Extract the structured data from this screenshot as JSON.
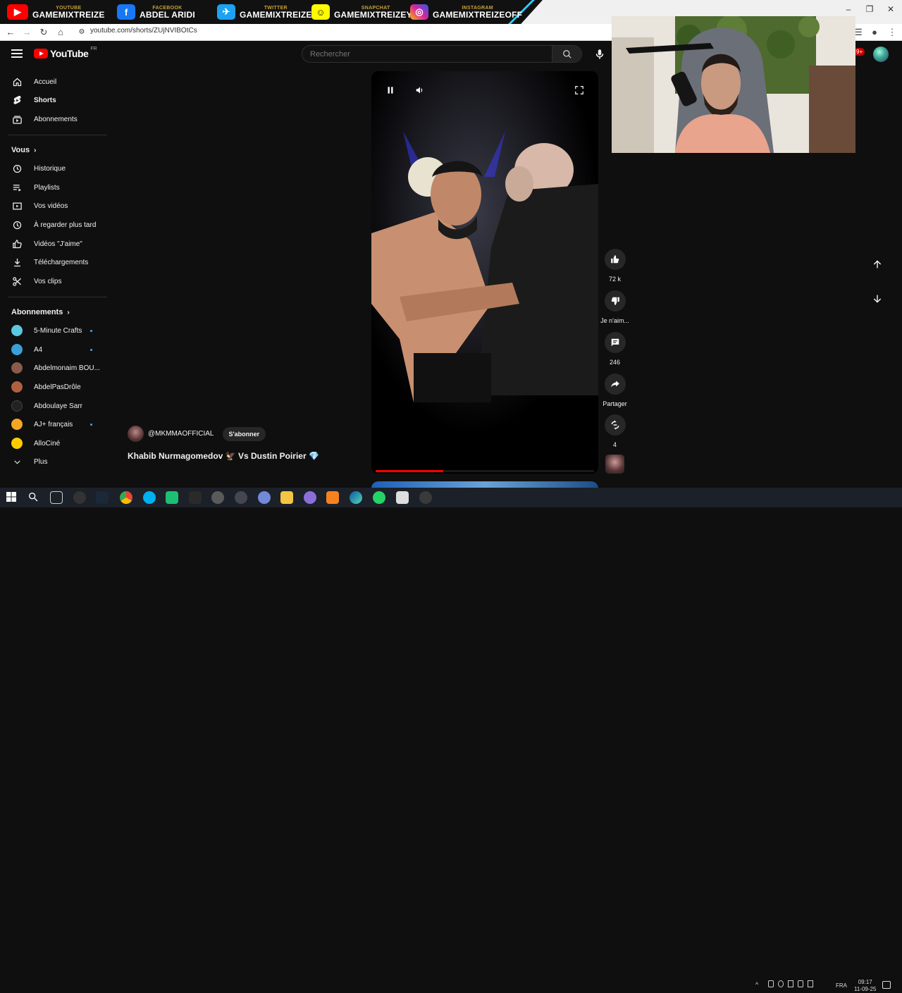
{
  "social": [
    {
      "small": "YOUTUBE",
      "name": "GAMEMIXTREIZE",
      "color": "#ff0000",
      "glyph": "▶"
    },
    {
      "small": "FACEBOOK",
      "name": "ABDEL ARIDI",
      "color": "#1877f2",
      "glyph": "f"
    },
    {
      "small": "TWITTER",
      "name": "GAMEMIXTREIZE",
      "color": "#1da1f2",
      "glyph": "✈"
    },
    {
      "small": "SNAPCHAT",
      "name": "GAMEMIXTREIZEYT",
      "color": "#fffc00",
      "glyph": "☺"
    },
    {
      "small": "INSTAGRAM",
      "name": "GAMEMIXTREIZEOFF",
      "color": "#d6249f",
      "glyph": "◎"
    }
  ],
  "window_controls": {
    "minimize": "–",
    "restore": "❐",
    "close": "✕"
  },
  "browser": {
    "url": "youtube.com/shorts/ZUjNVIBOtCs"
  },
  "header": {
    "logo": "YouTube",
    "region": "FR",
    "search_placeholder": "Rechercher",
    "notif_count": "9+"
  },
  "sidebar": {
    "main": [
      {
        "label": "Accueil",
        "icon": "home-icon"
      },
      {
        "label": "Shorts",
        "icon": "shorts-icon"
      },
      {
        "label": "Abonnements",
        "icon": "subscriptions-icon"
      }
    ],
    "you_title": "Vous",
    "you": [
      {
        "label": "Historique",
        "icon": "history-icon"
      },
      {
        "label": "Playlists",
        "icon": "playlists-icon"
      },
      {
        "label": "Vos vidéos",
        "icon": "your-videos-icon"
      },
      {
        "label": "À regarder plus tard",
        "icon": "watch-later-icon"
      },
      {
        "label": "Vidéos \"J'aime\"",
        "icon": "liked-videos-icon"
      },
      {
        "label": "Téléchargements",
        "icon": "downloads-icon"
      },
      {
        "label": "Vos clips",
        "icon": "clips-icon"
      }
    ],
    "subs_title": "Abonnements",
    "subs": [
      {
        "label": "5-Minute Crafts",
        "color": "#5bc8e0"
      },
      {
        "label": "A4",
        "color": "#3aa0d8"
      },
      {
        "label": "Abdelmonaim BOU...",
        "color": "#8a5a4a"
      },
      {
        "label": "AbdelPasDrôle",
        "color": "#b06040"
      },
      {
        "label": "Abdoulaye Sarr",
        "color": "#222222"
      },
      {
        "label": "AJ+ français",
        "color": "#f5a623"
      },
      {
        "label": "AlloCiné",
        "color": "#ffcc00"
      }
    ],
    "more": "Plus"
  },
  "short": {
    "channel": "@MKMMAOFFICIAL",
    "subscribe": "S'abonner",
    "title": "Khabib Nurmagomedov 🦅 Vs Dustin Poirier 💎",
    "progress": 0.31
  },
  "actions": {
    "likes": "72 k",
    "dislike": "Je n'aim...",
    "comments": "246",
    "share": "Partager",
    "remix": "4"
  },
  "taskbar": {
    "lang": "FRA",
    "time": "09:17",
    "date": "11-09-25"
  }
}
